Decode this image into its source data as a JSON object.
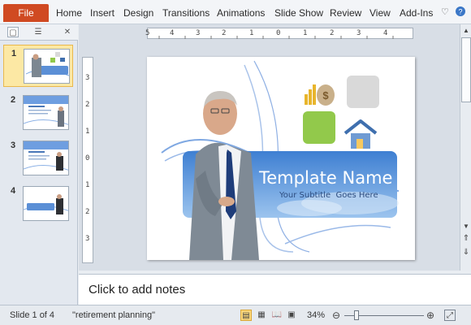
{
  "ribbon": {
    "file_tab": "File",
    "tabs": [
      "Home",
      "Insert",
      "Design",
      "Transitions",
      "Animations",
      "Slide Show",
      "Review",
      "View",
      "Add-Ins"
    ],
    "help_icon": "help-icon",
    "collapse_icon": "chevron-up-icon"
  },
  "panel": {
    "tab_slides_icon": "slides-icon",
    "tab_outline_icon": "outline-icon",
    "close_icon": "close-icon",
    "slides": [
      {
        "num": "1",
        "selected": true
      },
      {
        "num": "2",
        "selected": false
      },
      {
        "num": "3",
        "selected": false
      },
      {
        "num": "4",
        "selected": false
      }
    ]
  },
  "ruler": {
    "horizontal_ticks": [
      "5",
      "4",
      "3",
      "2",
      "1",
      "0",
      "1",
      "2",
      "3",
      "4"
    ],
    "vertical_ticks": [
      "3",
      "2",
      "1",
      "0",
      "1",
      "2",
      "3"
    ]
  },
  "slide": {
    "title": "Template Name",
    "subtitle": "Your Subtitle  Goes Here",
    "accent_color": "#5b8fd6",
    "green_tile": "#92c94b",
    "gray_tile": "#d9d9d9"
  },
  "notes": {
    "placeholder": "Click to add notes"
  },
  "status": {
    "slide_count": "Slide 1 of 4",
    "theme": "\"retirement planning\"",
    "zoom": "34%"
  }
}
